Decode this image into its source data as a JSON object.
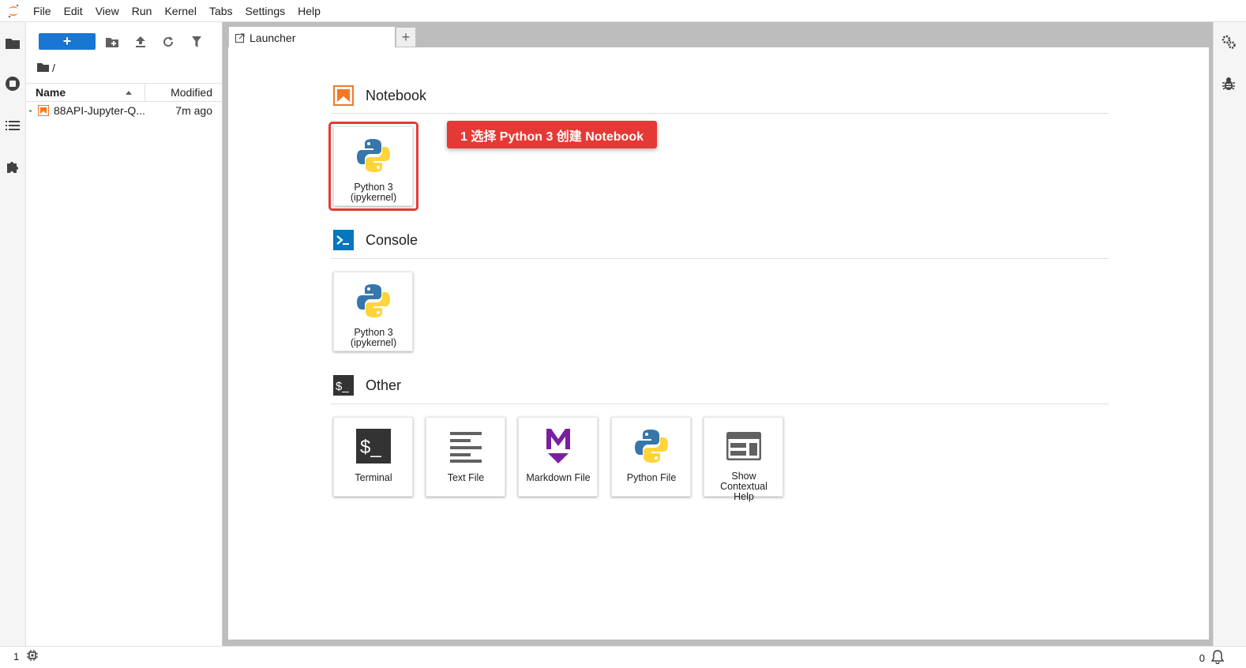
{
  "menubar": {
    "items": [
      "File",
      "Edit",
      "View",
      "Run",
      "Kernel",
      "Tabs",
      "Settings",
      "Help"
    ]
  },
  "filebrowser": {
    "new_button_label": "+",
    "breadcrumb": "/",
    "header": {
      "name": "Name",
      "modified": "Modified"
    },
    "files": [
      {
        "name": "88API-Jupyter-Q...",
        "modified": "7m ago",
        "icon": "notebook-icon"
      }
    ]
  },
  "tabs": [
    {
      "label": "Launcher",
      "icon": "launcher-icon"
    }
  ],
  "tab_add_label": "+",
  "launcher": {
    "sections": [
      {
        "title": "Notebook",
        "icon": "notebook-icon",
        "items": [
          {
            "label": "Python 3 (ipykernel)",
            "line1": "Python 3",
            "line2": "(ipykernel)",
            "icon": "python-icon"
          }
        ]
      },
      {
        "title": "Console",
        "icon": "console-icon",
        "items": [
          {
            "label": "Python 3 (ipykernel)",
            "line1": "Python 3",
            "line2": "(ipykernel)",
            "icon": "python-icon"
          }
        ]
      },
      {
        "title": "Other",
        "icon": "terminal-icon",
        "items": [
          {
            "label": "Terminal",
            "icon": "terminal-icon"
          },
          {
            "label": "Text File",
            "icon": "text-file-icon"
          },
          {
            "label": "Markdown File",
            "icon": "markdown-icon"
          },
          {
            "label": "Python File",
            "icon": "python-icon"
          },
          {
            "label": "Show Contextual Help",
            "line1": "Show",
            "line2": "Contextual",
            "line3": "Help",
            "icon": "help-icon"
          }
        ]
      }
    ]
  },
  "annotation": {
    "callout_text": "1 选择 Python 3 创建 Notebook",
    "color": "#e53935"
  },
  "statusbar": {
    "left_count": "1",
    "right_count": "0"
  },
  "colors": {
    "accent": "#1976d2",
    "notebook_orange": "#f37726",
    "console_blue": "#0277bd",
    "markdown_purple": "#7b1fa2"
  }
}
